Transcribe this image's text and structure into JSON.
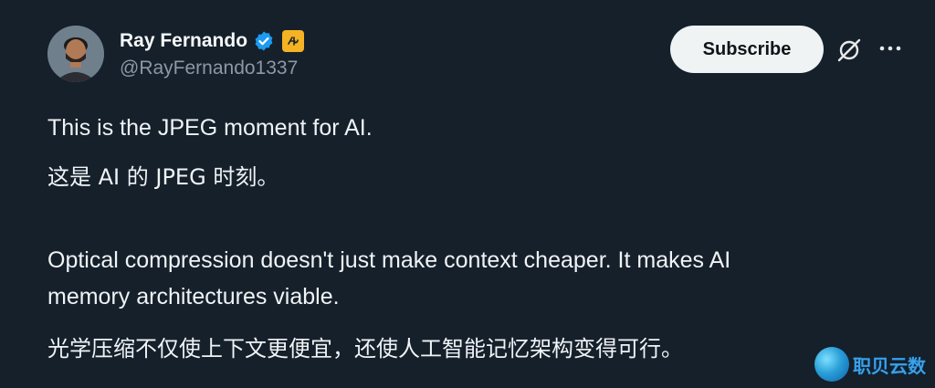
{
  "header": {
    "display_name": "Ray Fernando",
    "handle": "@RayFernando1337",
    "subscribe_label": "Subscribe",
    "verified_color": "#1d9bf0",
    "affiliate_badge_color": "#f5b323"
  },
  "tweet": {
    "line1": "This is the JPEG moment for AI.",
    "line2": "这是 AI 的 JPEG 时刻。",
    "line3": "Optical compression doesn't just make context cheaper. It makes AI",
    "line4": "memory architectures viable.",
    "line5": "光学压缩不仅使上下文更便宜，还使人工智能记忆架构变得可行。"
  },
  "watermark": {
    "text": "职贝云数"
  },
  "icons": {
    "verified": "verified-check-icon",
    "affiliate": "affiliate-badge-icon",
    "grok": "grok-icon",
    "more": "more-dots-icon"
  }
}
